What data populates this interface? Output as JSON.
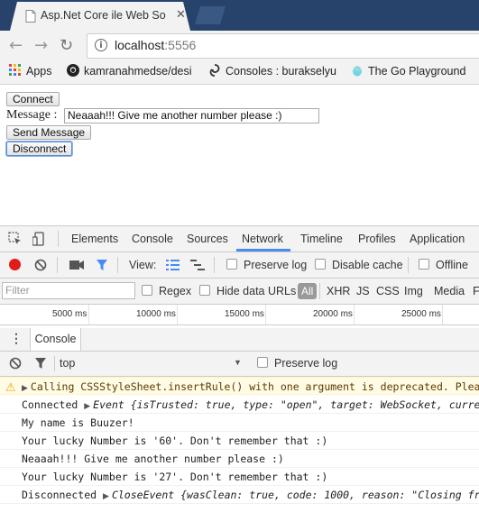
{
  "browser": {
    "tab_title": "Asp.Net Core ile Web So",
    "tab_close": "✕",
    "address_host": "localhost",
    "address_port": ":5556",
    "bookmarks": [
      {
        "label": "Apps"
      },
      {
        "label": "kamranahmedse/desi"
      },
      {
        "label": "Consoles : burakselyu"
      },
      {
        "label": "The Go Playground"
      }
    ]
  },
  "page": {
    "connect_label": "Connect",
    "message_label": "Message :",
    "message_value": "Neaaah!!! Give me another number please :)",
    "send_label": "Send Message",
    "disconnect_label": "Disconnect"
  },
  "devtools": {
    "tabs": [
      "Elements",
      "Console",
      "Sources",
      "Network",
      "Timeline",
      "Profiles",
      "Application"
    ],
    "active_tab": "Network",
    "view_label": "View:",
    "preserve_log": "Preserve log",
    "disable_cache": "Disable cache",
    "offline": "Offline",
    "filter_placeholder": "Filter",
    "regex": "Regex",
    "hide_data_urls": "Hide data URLs",
    "filter_types": [
      "All",
      "XHR",
      "JS",
      "CSS",
      "Img",
      "Media",
      "F"
    ],
    "timeline_ticks": [
      "5000 ms",
      "10000 ms",
      "15000 ms",
      "20000 ms",
      "25000 ms"
    ],
    "drawer_tab": "Console",
    "context": "top",
    "console_preserve_log": "Preserve log"
  },
  "console": {
    "warning": "Calling CSSStyleSheet.insertRule() with one argument is deprecated. Plea",
    "connected_prefix": "Connected",
    "connected_obj": "Event {isTrusted: true, type: \"open\", target: WebSocket, curre",
    "lines": [
      "My name is Buuzer!",
      "Your lucky Number is '60'. Don't remember that :)",
      "Neaaah!!! Give me another number please :)",
      "Your lucky Number is '27'. Don't remember that :)"
    ],
    "disconnected_prefix": "Disconnected",
    "disconnected_obj": "CloseEvent {wasClean: true, code: 1000, reason: \"Closing fr"
  },
  "colors": {
    "tabstrip": "#27436b",
    "accent_blue": "#4a8af4",
    "record_red": "#e21b1b",
    "warning_bg": "#fffbe5"
  }
}
